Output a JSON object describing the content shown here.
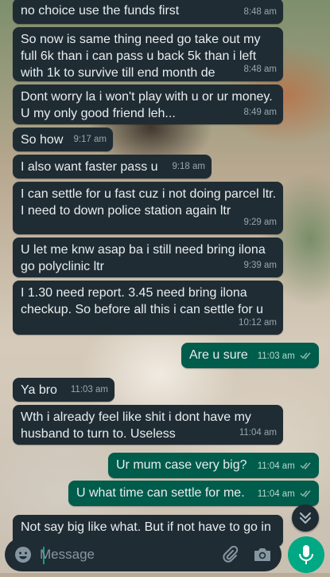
{
  "messages": [
    {
      "dir": "in",
      "text": "no choice use the funds first",
      "time": "8:48 am"
    },
    {
      "dir": "in",
      "text": "So now is same thing need go take out my full 6k than i can pass u back 5k than i left with 1k to survive till end month de",
      "time": "8:48 am"
    },
    {
      "dir": "in",
      "text": "Dont worry la i won't play with u or ur money. U my only good friend leh...",
      "time": "8:49 am"
    },
    {
      "dir": "in",
      "text": "So how",
      "time": "9:17 am"
    },
    {
      "dir": "in",
      "text": "I also want faster pass u",
      "time": "9:18 am"
    },
    {
      "dir": "in",
      "text": "I can settle for u fast cuz i not doing parcel ltr. I need to down police station again ltr",
      "time": "9:29 am"
    },
    {
      "dir": "in",
      "text": "U let me knw asap ba i still need bring ilona go polyclinic ltr",
      "time": "9:39 am"
    },
    {
      "dir": "in",
      "text": "I 1.30 need report. 3.45 need bring ilona checkup. So before all this i can settle for u",
      "time": "10:12 am"
    },
    {
      "dir": "out",
      "text": "Are u sure",
      "time": "11:03 am"
    },
    {
      "dir": "in",
      "text": "Ya bro",
      "time": "11:03 am"
    },
    {
      "dir": "in",
      "text": "Wth i already feel like shit i dont have my husband to turn to. Useless",
      "time": "11:04 am"
    },
    {
      "dir": "out",
      "text": "Ur mum case very big?",
      "time": "11:04 am"
    },
    {
      "dir": "out",
      "text": "U what time can settle for me.",
      "time": "11:04 am"
    },
    {
      "dir": "in",
      "text": "Not say big like what. But if not have to go in",
      "time": ""
    }
  ],
  "composer": {
    "placeholder": "Message"
  },
  "icons": {
    "emoji": "emoji-icon",
    "attach": "paperclip-icon",
    "camera": "camera-icon",
    "mic": "microphone-icon",
    "scroll": "chevron-double-down-icon",
    "read": "double-check-icon"
  },
  "colors": {
    "incoming_bubble": "#1f2c34",
    "outgoing_bubble": "#005c4b",
    "text": "#e9edef",
    "meta": "#9aa6ad",
    "accent": "#00a884"
  }
}
